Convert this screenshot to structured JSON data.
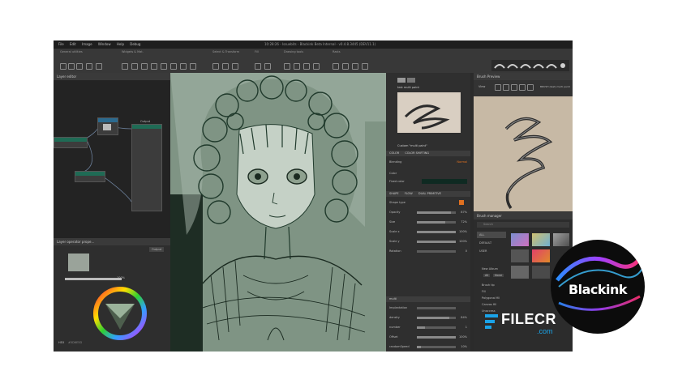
{
  "menubar": {
    "items": [
      "File",
      "Edit",
      "Image",
      "Window",
      "Help",
      "Debug"
    ],
    "title": "10:28:26 - Issuebits - Blackink Beta Internal - v0.4.8.3445 (DEV11.1)"
  },
  "toolbar": {
    "sections": [
      "General utilities",
      "Widgets & Mat.",
      "Select & Transform",
      "Fill",
      "Drawing tools",
      "Rasts"
    ]
  },
  "layer_editor": {
    "title": "Layer editor",
    "node_label": "Output"
  },
  "layer_operator": {
    "title": "Layer operator prope...",
    "output_btn": "Output",
    "opacity_value": "100%",
    "hex_label": "HEX",
    "hex_value": "#5D6E5D"
  },
  "brush_panel": {
    "preset_name": "test multi paint",
    "custom_label": "Custom \"multi paint\"",
    "tabs": [
      "COLOR",
      "COLOR SHIFTING"
    ],
    "blending_label": "Blending",
    "blending_value": "Normal",
    "color_label": "Color",
    "fixed_color_label": "Fixed color",
    "shape_tabs": [
      "SHAPE",
      "FLOW",
      "DUAL PRIMITIVE"
    ],
    "shape_type_label": "Shape type",
    "params": [
      {
        "label": "Opacity",
        "value": "87%",
        "level": 0.87
      },
      {
        "label": "Size",
        "value": "72%",
        "level": 0.72
      },
      {
        "label": "Scale x",
        "value": "100%",
        "level": 1
      },
      {
        "label": "Scale y",
        "value": "100%",
        "level": 1
      },
      {
        "label": "Rotation",
        "value": "0",
        "level": 0
      }
    ],
    "multi_tab": "multi",
    "multi_params": [
      {
        "label": "Implantation",
        "value": "",
        "level": 0
      },
      {
        "label": "density",
        "value": "84%",
        "level": 0.84
      },
      {
        "label": "number",
        "value": "1",
        "level": 0.2
      },
      {
        "label": "Offset",
        "value": "100%",
        "level": 1
      },
      {
        "label": "randomSpeed",
        "value": "10%",
        "level": 0.1
      }
    ]
  },
  "brush_preview": {
    "title": "Brush Preview",
    "view_label": "View",
    "brush_label": "BRUSH (test) multi paint"
  },
  "brush_manager": {
    "title": "Brush manager",
    "search_placeholder": "Search",
    "categories": [
      "ALL",
      "DEFAULT",
      "USER"
    ],
    "new_album_label": "New Album",
    "all_btn": "All",
    "none_btn": "None",
    "filters": [
      "Brush tip",
      "Fill",
      "Polygonal fill",
      "Canvas fill",
      "Unaccess"
    ]
  },
  "watermark": {
    "logo_text": "Blackink",
    "filecr_text": "FILECR",
    "filecr_domain": ".com"
  },
  "colors": {
    "accent_green": "#1f6b55",
    "accent_orange": "#e07020",
    "canvas_bg": "#7f9484",
    "preview_bg": "#c7b9a5"
  }
}
